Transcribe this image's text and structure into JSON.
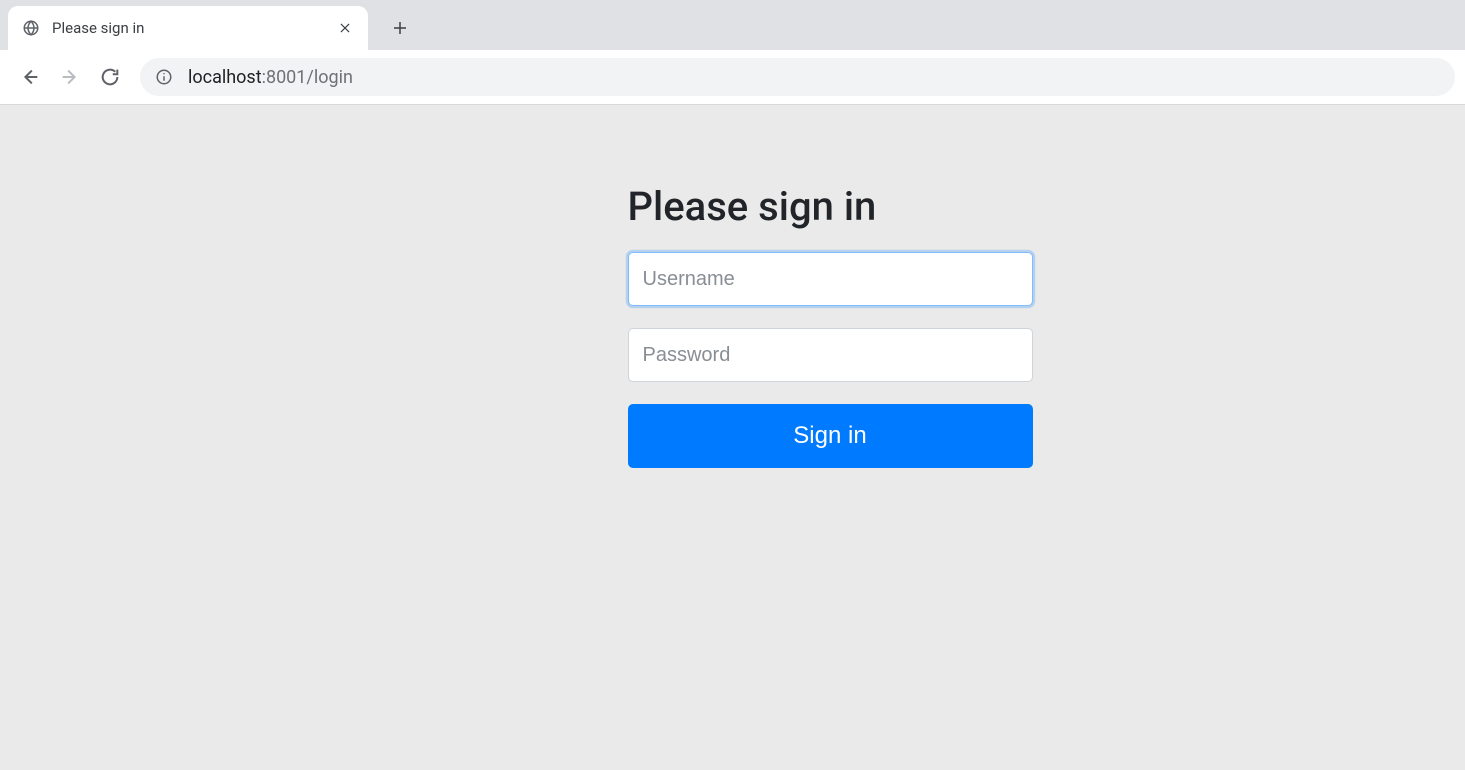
{
  "browser": {
    "tab_title": "Please sign in",
    "url_host": "localhost",
    "url_rest": ":8001/login"
  },
  "login": {
    "heading": "Please sign in",
    "username_placeholder": "Username",
    "username_value": "",
    "password_placeholder": "Password",
    "password_value": "",
    "submit_label": "Sign in"
  }
}
